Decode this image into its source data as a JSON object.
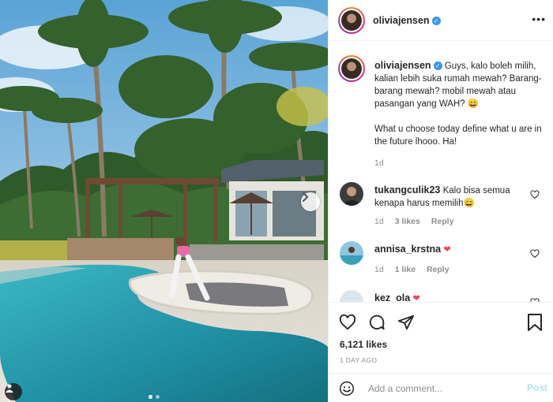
{
  "post": {
    "username": "oliviajensen",
    "caption_p1": "Guys, kalo boleh milih, kalian lebih suka rumah mewah? Barang-barang mewah? mobil mewah atau pasangan yang WAH? 😄",
    "caption_p2": "What u choose today define what u are in the future lhooo. Ha!",
    "caption_age": "1d"
  },
  "comments": [
    {
      "username": "tukangculik23",
      "text": "Kalo bisa semua kenapa harus memilih😄",
      "age": "1d",
      "likes": "3 likes",
      "reply": "Reply"
    },
    {
      "username": "annisa_krstna",
      "text": "❤",
      "age": "1d",
      "likes": "1 like",
      "reply": "Reply"
    },
    {
      "username": "kez_ola",
      "text": "❤"
    }
  ],
  "stats": {
    "likes": "6,121 likes",
    "date": "1 DAY AGO"
  },
  "add_comment": {
    "placeholder": "Add a comment...",
    "post_label": "Post"
  },
  "icons": {
    "verified": "verified-badge-icon",
    "more": "more-options-icon",
    "heart": "heart-icon",
    "comment": "comment-icon",
    "share": "share-icon",
    "save": "bookmark-icon",
    "emoji": "emoji-icon",
    "next": "chevron-right-icon",
    "tag": "user-tag-icon"
  },
  "colors": {
    "accent": "#3897f0",
    "heart_red": "#ed4956",
    "post_disabled": "#b2dffc"
  }
}
